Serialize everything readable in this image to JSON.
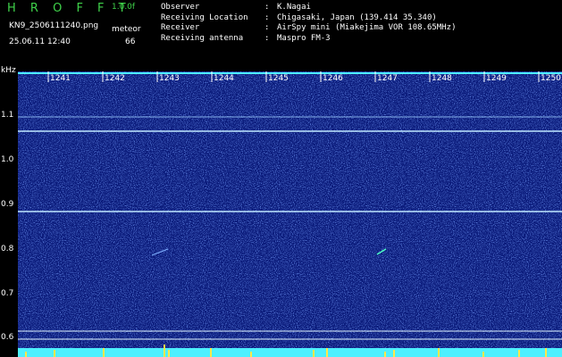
{
  "header": {
    "title": "H R O F F T",
    "version": "1.0.0f",
    "filename": "KN9_2506111240.png",
    "timestamp": "25.06.11 12:40",
    "meteor_label": "meteor",
    "meteor_count": "66"
  },
  "info": [
    {
      "key": "Observer",
      "value": "K.Nagai"
    },
    {
      "key": "Receiving Location",
      "value": "Chigasaki, Japan (139.414 35.340)"
    },
    {
      "key": "Receiver",
      "value": "AirSpy mini (Miakejima VOR 108.65MHz)"
    },
    {
      "key": "Receiving antenna",
      "value": "Maspro FM-3"
    }
  ],
  "y_unit": "kHz",
  "y_ticks": [
    "1.1",
    "1.0",
    "0.9",
    "0.8",
    "0.7",
    "0.6"
  ],
  "x_ticks": [
    "1241",
    "1242",
    "1243",
    "1244",
    "1245",
    "1246",
    "1247",
    "1248",
    "1249",
    "1250"
  ],
  "colors": {
    "background": "#000000",
    "title": "#3fd24a",
    "spectrogram_base": "#0a1a7a",
    "noise_bright": "#4d7cff",
    "trace": "#bfe8ff",
    "baseline": "#4df0ff",
    "burst": "#ffe84a",
    "tick": "#ffffff"
  }
}
